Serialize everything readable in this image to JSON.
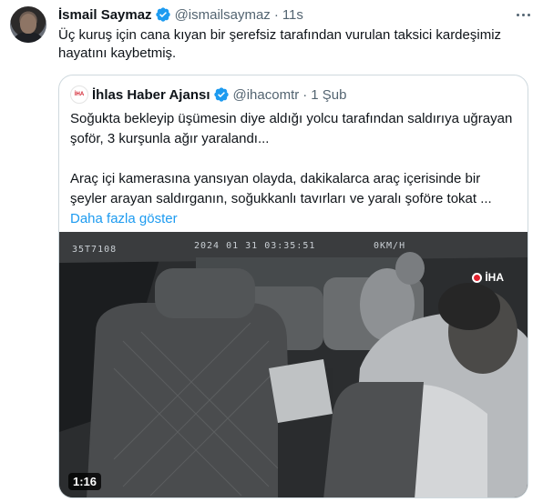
{
  "tweet": {
    "author_name": "İsmail Saymaz",
    "handle": "@ismailsaymaz",
    "separator": "·",
    "time": "11s",
    "text": "Üç kuruş için cana kıyan bir şerefsiz tarafından vurulan taksici kardeşimiz hayatını kaybetmiş.",
    "verified_icon": "verified-badge-icon",
    "more_icon": "more-options-icon"
  },
  "quote": {
    "author_name": "İhlas Haber Ajansı",
    "handle": "@ihacomtr",
    "separator": "·",
    "time": "1 Şub",
    "logo_text": "İHA",
    "paragraph1": "Soğukta bekleyip üşümesin diye aldığı yolcu tarafından saldırıya uğrayan şoför, 3 kurşunla ağır yaralandı...",
    "paragraph2": "Araç içi kamerasına yansıyan olayda, dakikalarca araç içerisinde bir şeyler arayan saldırganın, soğukkanlı tavırları ve yaralı şoföre tokat ...",
    "show_more": "Daha fazla göster"
  },
  "video": {
    "osd_plate": "35T7108",
    "osd_datetime": "2024 01 31 03:35:51",
    "osd_speed": "0KM/H",
    "watermark": "İHA",
    "duration": "1:16"
  },
  "colors": {
    "accent": "#1d9bf0",
    "text_primary": "#0f1419",
    "text_secondary": "#536471",
    "border": "#cfd9de"
  }
}
